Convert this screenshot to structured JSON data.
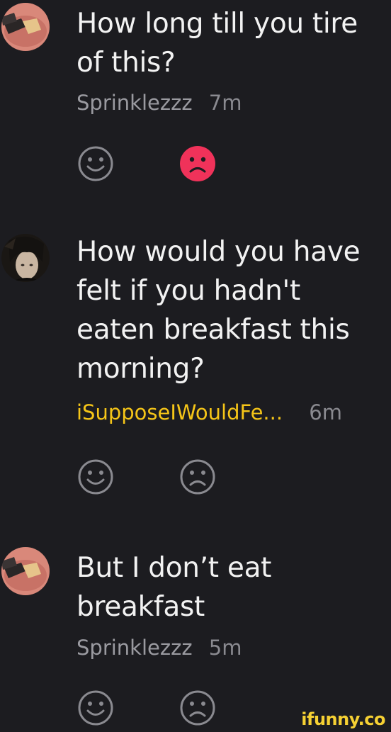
{
  "comments": [
    {
      "lines": [
        "How long till you tire",
        "of this?"
      ],
      "username": "Sprinklezzz",
      "time": "7m",
      "avatar": "meme-avatar-icon",
      "frown_active": true
    },
    {
      "lines": [
        "How would you have",
        "felt if you hadn't",
        "eaten breakfast this",
        "morning?"
      ],
      "username": "iSupposeIWouldFe...",
      "time": "6m",
      "avatar": "profile-photo-avatar",
      "frown_active": false
    },
    {
      "lines": [
        "But I don’t eat",
        "breakfast"
      ],
      "username": "Sprinklezzz",
      "time": "5m",
      "avatar": "meme-avatar-icon",
      "frown_active": false
    }
  ],
  "colors": {
    "background": "#1c1c20",
    "highlight_username": "#f5c518",
    "frown_active": "#f0325a",
    "icon_idle": "#8a8a90",
    "watermark": "#f5d033"
  },
  "watermark": "ifunny.co"
}
